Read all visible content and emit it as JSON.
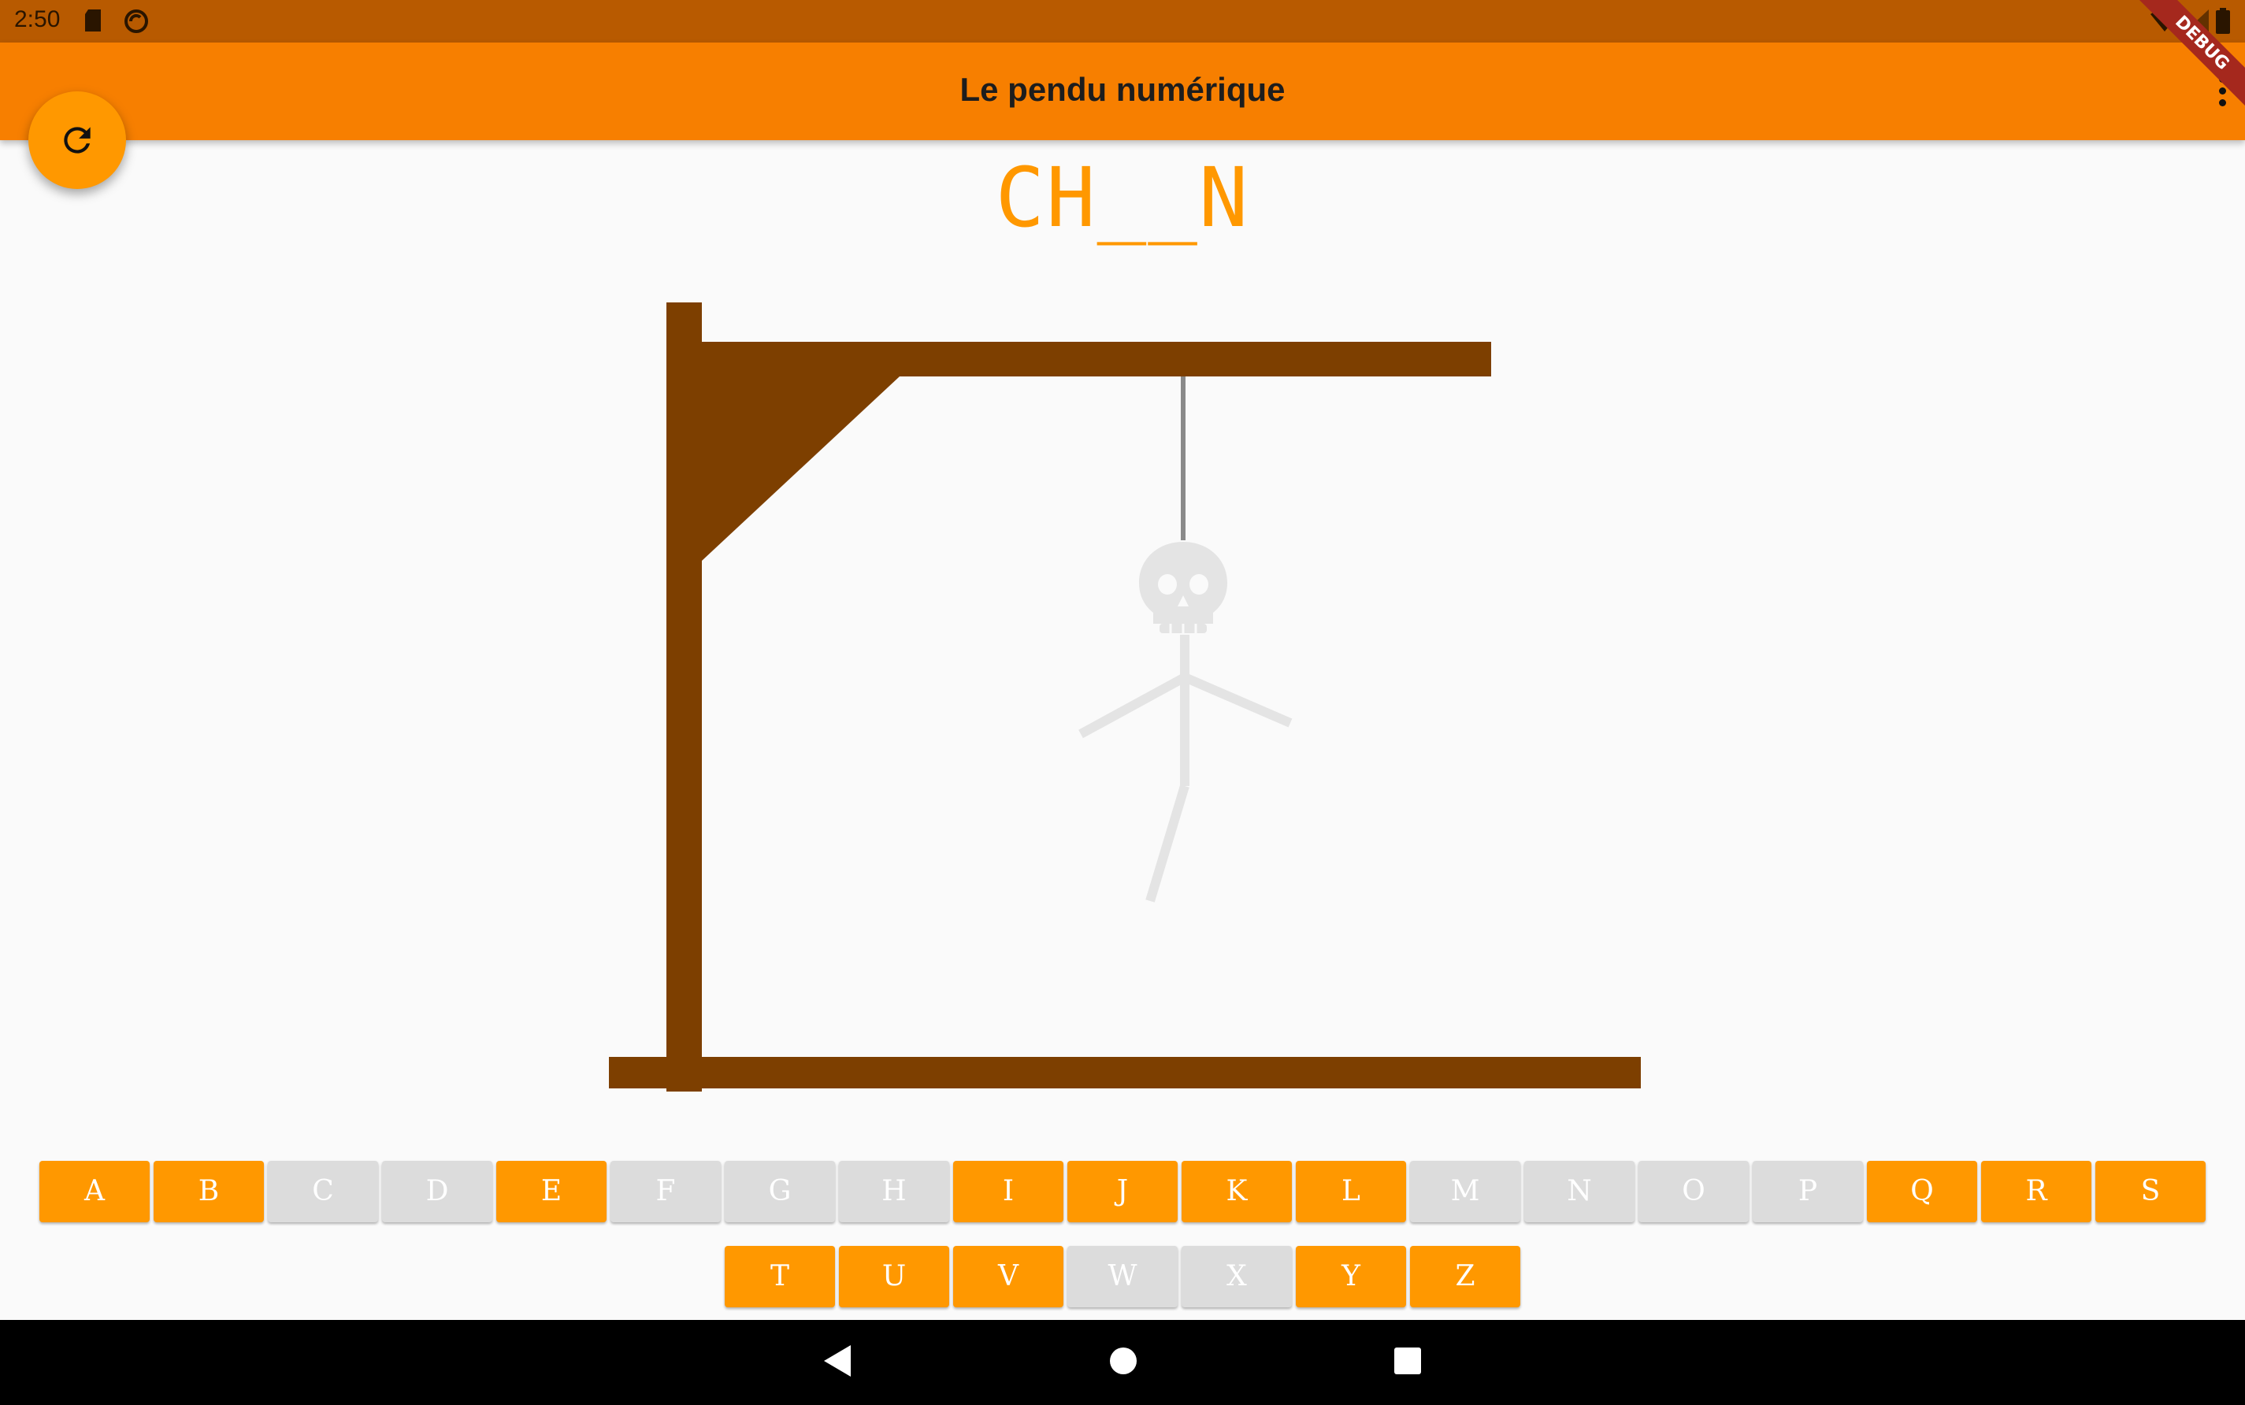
{
  "status_bar": {
    "time": "2:50",
    "icons": [
      "sd-card-icon",
      "sync-icon",
      "wifi-icon",
      "signal-icon",
      "battery-icon"
    ]
  },
  "app_bar": {
    "title": "Le pendu numérique",
    "background": "#f77f00",
    "menu_icon": "more-vert-icon"
  },
  "fab": {
    "icon": "refresh-icon",
    "color": "#ff9800"
  },
  "debug_banner": {
    "label": "DEBUG"
  },
  "game": {
    "masked_word": "CH__N",
    "accent_color": "#ff9800",
    "gallows_color": "#7d3f00"
  },
  "keyboard": {
    "rows": [
      [
        {
          "letter": "A",
          "state": "available"
        },
        {
          "letter": "B",
          "state": "available"
        },
        {
          "letter": "C",
          "state": "used"
        },
        {
          "letter": "D",
          "state": "used"
        },
        {
          "letter": "E",
          "state": "available"
        },
        {
          "letter": "F",
          "state": "used"
        },
        {
          "letter": "G",
          "state": "used"
        },
        {
          "letter": "H",
          "state": "used"
        },
        {
          "letter": "I",
          "state": "available"
        },
        {
          "letter": "J",
          "state": "available"
        },
        {
          "letter": "K",
          "state": "available"
        },
        {
          "letter": "L",
          "state": "available"
        },
        {
          "letter": "M",
          "state": "used"
        },
        {
          "letter": "N",
          "state": "used"
        },
        {
          "letter": "O",
          "state": "used"
        },
        {
          "letter": "P",
          "state": "used"
        },
        {
          "letter": "Q",
          "state": "available"
        },
        {
          "letter": "R",
          "state": "available"
        },
        {
          "letter": "S",
          "state": "available"
        }
      ],
      [
        {
          "letter": "T",
          "state": "available"
        },
        {
          "letter": "U",
          "state": "available"
        },
        {
          "letter": "V",
          "state": "available"
        },
        {
          "letter": "W",
          "state": "used"
        },
        {
          "letter": "X",
          "state": "used"
        },
        {
          "letter": "Y",
          "state": "available"
        },
        {
          "letter": "Z",
          "state": "available"
        }
      ]
    ]
  },
  "nav_bar": {
    "buttons": [
      "back-icon",
      "home-icon",
      "recents-icon"
    ]
  }
}
